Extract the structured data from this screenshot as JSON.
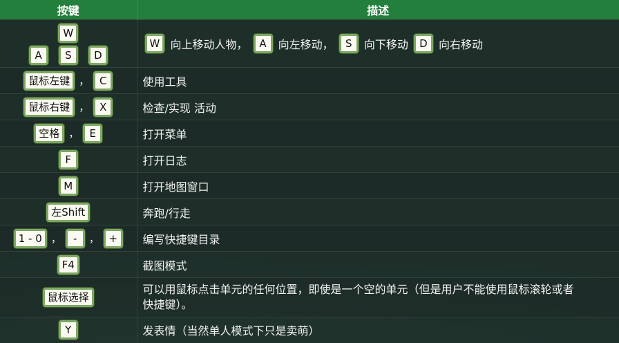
{
  "header": {
    "col_keys": "按键",
    "col_desc": "描述"
  },
  "rows": {
    "move": {
      "keys": [
        "W",
        "A",
        "S",
        "D"
      ],
      "desc": {
        "w_text": "向上移动人物，",
        "a_text": "向左移动，",
        "s_text": "向下移动",
        "d_text": "向右移动"
      }
    },
    "use_tool": {
      "keys": [
        "鼠标左键",
        "C"
      ],
      "desc": "使用工具"
    },
    "check": {
      "keys": [
        "鼠标右键",
        "X"
      ],
      "desc": "检查/实现 活动"
    },
    "menu": {
      "keys": [
        "空格",
        "E"
      ],
      "desc": "打开菜单"
    },
    "journal": {
      "keys": [
        "F"
      ],
      "desc": "打开日志"
    },
    "map": {
      "keys": [
        "M"
      ],
      "desc": "打开地图窗口"
    },
    "run": {
      "keys": [
        "左Shift"
      ],
      "desc": "奔跑/行走"
    },
    "hotkeys": {
      "keys": [
        "1 - 0",
        "-",
        "+"
      ],
      "desc": "编写快捷键目录"
    },
    "screenshot": {
      "keys": [
        "F4"
      ],
      "desc": "截图模式"
    },
    "select": {
      "keys": [
        "鼠标选择"
      ],
      "desc_line1": "可以用鼠标点击单元的任何位置，即使是一个空的单元（但是用户不能使用鼠标滚轮或者",
      "desc_line2": "快捷键）。"
    },
    "emote": {
      "keys": [
        "Y"
      ],
      "desc": "发表情（当然单人模式下只是卖萌）"
    }
  },
  "separator": "，"
}
